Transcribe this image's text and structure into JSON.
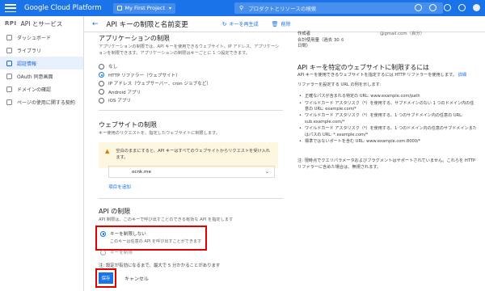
{
  "topbar": {
    "brand": "Google Cloud Platform",
    "project": "My First Project",
    "search_placeholder": "プロダクトとリソースの検索"
  },
  "sidebar": {
    "title": "API とサービス",
    "items": [
      {
        "label": "ダッシュボード",
        "icon": "dashboard-icon"
      },
      {
        "label": "ライブラリ",
        "icon": "library-icon"
      },
      {
        "label": "認証情報",
        "icon": "key-icon",
        "active": true
      },
      {
        "label": "OAuth 同意画面",
        "icon": "consent-icon"
      },
      {
        "label": "ドメインの確認",
        "icon": "checkbox-icon"
      },
      {
        "label": "ページの使用に関する契約",
        "icon": "settings-icon"
      }
    ]
  },
  "header": {
    "title": "API キーの制限と名前変更",
    "regenerate_label": "キーを再生成",
    "delete_label": "削除"
  },
  "app_restriction": {
    "title": "アプリケーションの制限",
    "description": "アプリケーションの制限では、API キーを使用できるウェブサイト、IP アドレス、アプリケーションを制限できます。アプリケーションの制限はキーごとに 1 つ設定できます。",
    "options": [
      "なし",
      "HTTP リファラー（ウェブサイト）",
      "IP アドレス（ウェブサーバー、cron ジョブなど）",
      "Android アプリ",
      "iOS アプリ"
    ],
    "selected_index": 1
  },
  "website_restriction": {
    "title": "ウェブサイトの制限",
    "description": "キー使用のリクエストを、指定したウェブサイトに制限します。",
    "warning": "空白のままにすると、API キーはすべてのウェブサイトからリクエストを受け入れます。",
    "site_value": "ocnk.me",
    "add_link": "項目を追加"
  },
  "api_restriction": {
    "title": "API の制限",
    "description": "API 制限は、このキーで呼び出すことのできる有効な API を指定します",
    "option_none": "キーを制限しない",
    "option_none_sub": "このキーは任意の API を呼び出すことができます",
    "option_restrict": "キーを制限"
  },
  "footer": {
    "note": "注: 設定が有効になるまで、最大で 5 分かかることがあります",
    "save_label": "保存",
    "cancel_label": "キャンセル"
  },
  "info": {
    "creator_label": "作成者",
    "creator_value": "@gmail.com（自分）",
    "usage_label": "合計使用量（過去 30 日間）",
    "usage_value": "6",
    "title": "API キーを特定のウェブサイトに制限するには",
    "intro": "API キーを使用できるウェブサイトを指定するには HTTP リファラーを使用します。",
    "intro_link": "詳細",
    "list_intro": "リファラーを設定する URL の例を示します:",
    "bullets": [
      "正確なパスが含まれる特定の URL: www.example.com/path",
      "ワイルドカード アスタリスク（*）を使用する、サブドメインのない 1 つのドメイン内の任意の URL: example.com/*",
      "ワイルドカード アスタリスク（*）を使用する、1 つのサブドメイン内の任意の URL: sub.example.com/*",
      "ワイルドカード アスタリスク（*）を使用する、1 つのドメイン内の任意のサブドメインまたはパスの URL: *.example.com/*",
      "標準ではないポートを含む URL: www.example.com:8000/*"
    ],
    "footnote": "注: 現時点でクエリパラメータおよびフラグメントはサポートされていません。これらを HTTP リファラーに含めた場合は、無視されます。"
  },
  "colors": {
    "topbar": "#1a73e8",
    "highlight": "#e50000",
    "accent": "#1a73e8",
    "warning_bg": "#fef7e0"
  }
}
